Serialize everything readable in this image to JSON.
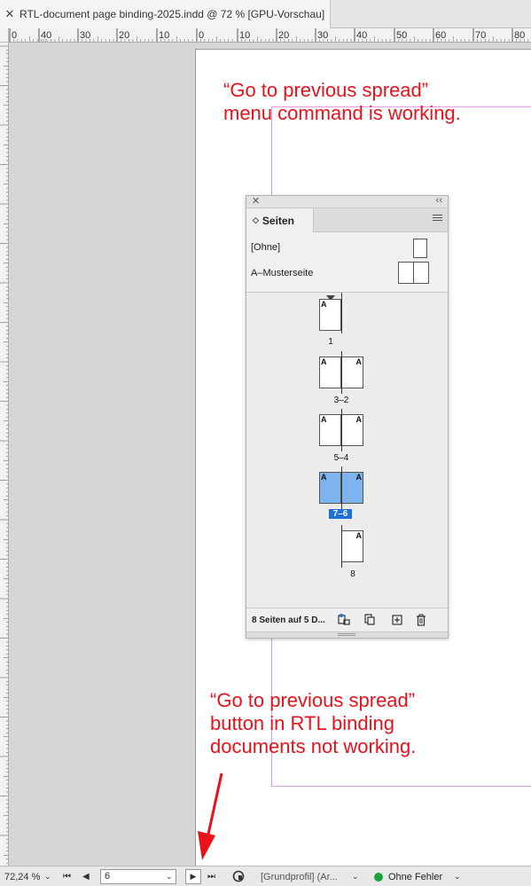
{
  "tab": {
    "close_glyph": "✕",
    "title": "RTL-document page binding-2025.indd @ 72 % [GPU-Vorschau]"
  },
  "ruler": {
    "h_labels": [
      "0",
      "40",
      "30",
      "20",
      "10",
      "0",
      "10",
      "20",
      "30",
      "40",
      "50",
      "60",
      "70",
      "80"
    ]
  },
  "annotations": {
    "top": [
      "“Go to previous spread”",
      "menu command is working."
    ],
    "bottom": [
      "“Go to previous spread”",
      "button in RTL binding",
      "documents not working."
    ],
    "color": "#e8121a"
  },
  "pages_panel": {
    "close_glyph": "✕",
    "collapse_glyph": "‹‹",
    "tab_label": "Seiten",
    "tab_icon": "updown-arrows-icon",
    "menu_icon": "panel-menu-icon",
    "masters": [
      {
        "label": "[Ohne]",
        "thumb": "single"
      },
      {
        "label": "A–Musterseite",
        "thumb": "spread"
      }
    ],
    "spreads": [
      {
        "number": "1",
        "pages": [
          "A"
        ],
        "type": "single-left",
        "selected": false,
        "current": true
      },
      {
        "number": "3–2",
        "pages": [
          "A",
          "A"
        ],
        "type": "spread",
        "selected": false
      },
      {
        "number": "5–4",
        "pages": [
          "A",
          "A"
        ],
        "type": "spread",
        "selected": false
      },
      {
        "number": "7–6",
        "pages": [
          "A",
          "A"
        ],
        "type": "spread",
        "selected": true
      },
      {
        "number": "8",
        "pages": [
          "A"
        ],
        "type": "single-right",
        "selected": false
      }
    ],
    "footer_text": "8 Seiten auf 5 D...",
    "footer_icons": [
      "edit-page-size-icon",
      "new-page-icon-dropdown",
      "add-page-icon",
      "trash-icon"
    ],
    "selection_color": "#7db4ee",
    "number_highlight_color": "#1a6fd8"
  },
  "statusbar": {
    "zoom": "72,24 %",
    "zoom_caret": "⌄",
    "first_glyph": "⏮",
    "prev_glyph": "◀",
    "page_value": "6",
    "page_caret": "⌄",
    "next_glyph": "▶",
    "last_glyph": "⏭",
    "profile": "[Grundprofil] (Ar...",
    "profile_caret": "⌄",
    "preflight": "Ohne Fehler",
    "preflight_caret": "⌄",
    "preflight_color": "#1aa33a"
  }
}
